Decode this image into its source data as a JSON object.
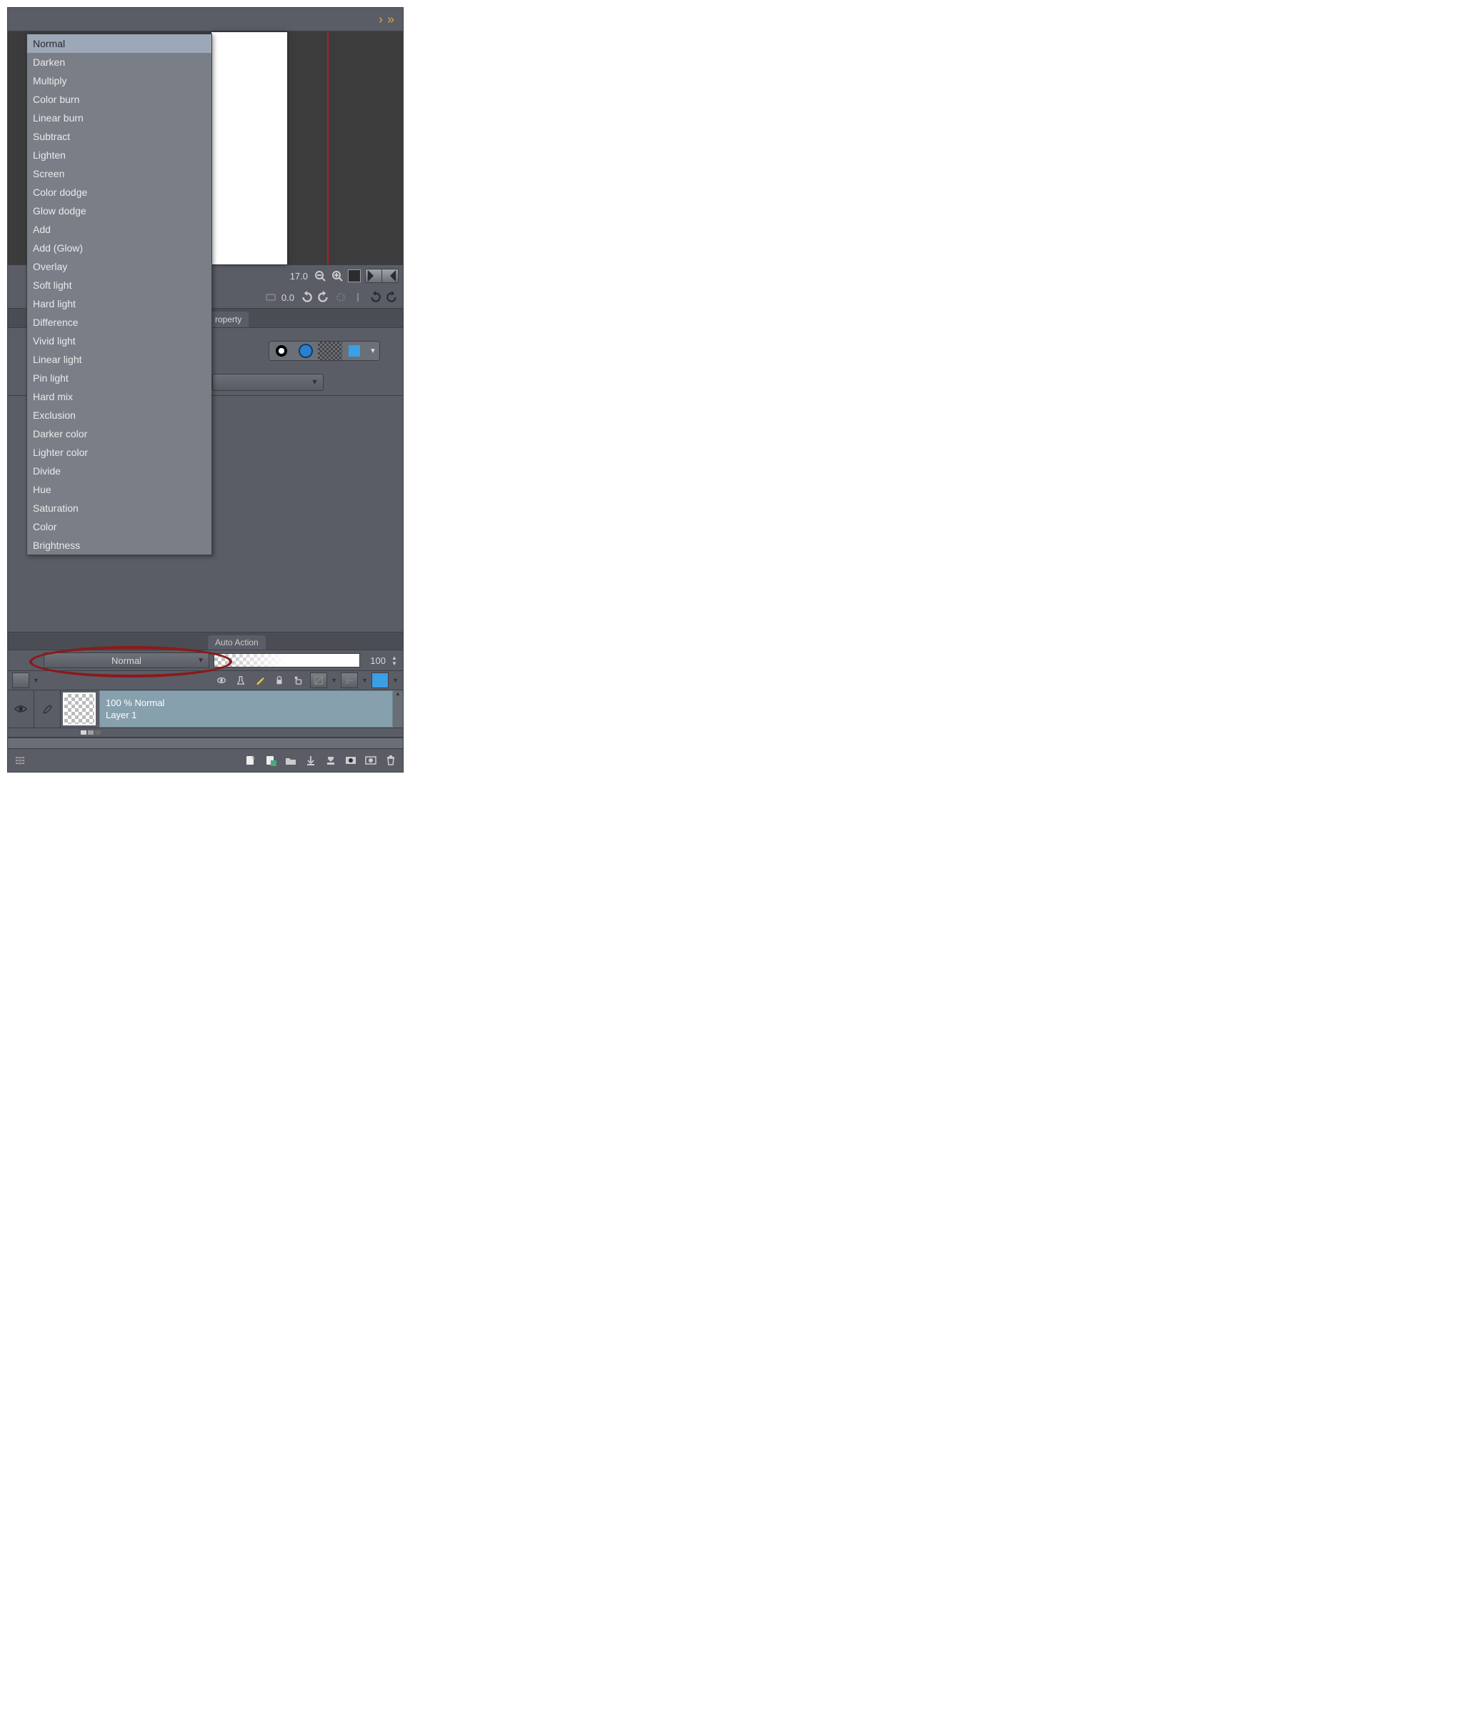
{
  "header": {},
  "navigator": {
    "zoom_value": "17.0",
    "angle_value": "0.0"
  },
  "tab_property": "roperty",
  "auto_action_tab": "Auto Action",
  "blend_mode_combo": {
    "selected": "Normal"
  },
  "opacity": {
    "value": "100"
  },
  "layer": {
    "info_line": "100 % Normal",
    "name": "Layer 1"
  },
  "blend_modes": [
    "Normal",
    "Darken",
    "Multiply",
    "Color burn",
    "Linear burn",
    "Subtract",
    "Lighten",
    "Screen",
    "Color dodge",
    "Glow dodge",
    "Add",
    "Add (Glow)",
    "Overlay",
    "Soft light",
    "Hard light",
    "Difference",
    "Vivid light",
    "Linear light",
    "Pin light",
    "Hard mix",
    "Exclusion",
    "Darker color",
    "Lighter color",
    "Divide",
    "Hue",
    "Saturation",
    "Color",
    "Brightness"
  ]
}
